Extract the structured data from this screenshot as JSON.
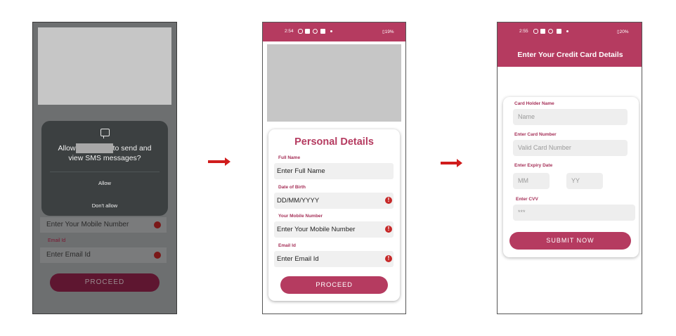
{
  "screen1": {
    "fields": [
      "Enter Your Mobile Number",
      "Email Id",
      "Enter Email Id"
    ],
    "proceed": "PROCEED",
    "dialog": {
      "icon": "message-icon",
      "title_before": "Allow",
      "title_after": "to send and",
      "title_line2": "view SMS messages?",
      "allow": "Allow",
      "deny": "Don't allow"
    }
  },
  "screen2": {
    "status": {
      "time": "2:54",
      "battery": "19%"
    },
    "title": "Personal Details",
    "labels": [
      "Full Name",
      "Date of Birth",
      "Your Mobile Number",
      "Email Id"
    ],
    "placeholders": [
      "Enter Full Name",
      "DD/MM/YYYY",
      "Enter Your Mobile Number",
      "Enter Email Id"
    ],
    "error_mark": "!",
    "proceed": "PROCEED"
  },
  "screen3": {
    "status": {
      "time": "2:55",
      "battery": "20%"
    },
    "title": "Enter Your Credit Card Details",
    "labels": [
      "Card Holder Name",
      "Enter Card Number",
      "Enter Expiry Date",
      "Enter CVV"
    ],
    "placeholders": {
      "name": "Name",
      "number": "Valid Card Number",
      "mm": "MM",
      "yy": "YY",
      "cvv": "***"
    },
    "submit": "SUBMIT NOW"
  },
  "colors": {
    "accent": "#b53b60",
    "error": "#c62828",
    "arrow": "#d01c1c"
  }
}
